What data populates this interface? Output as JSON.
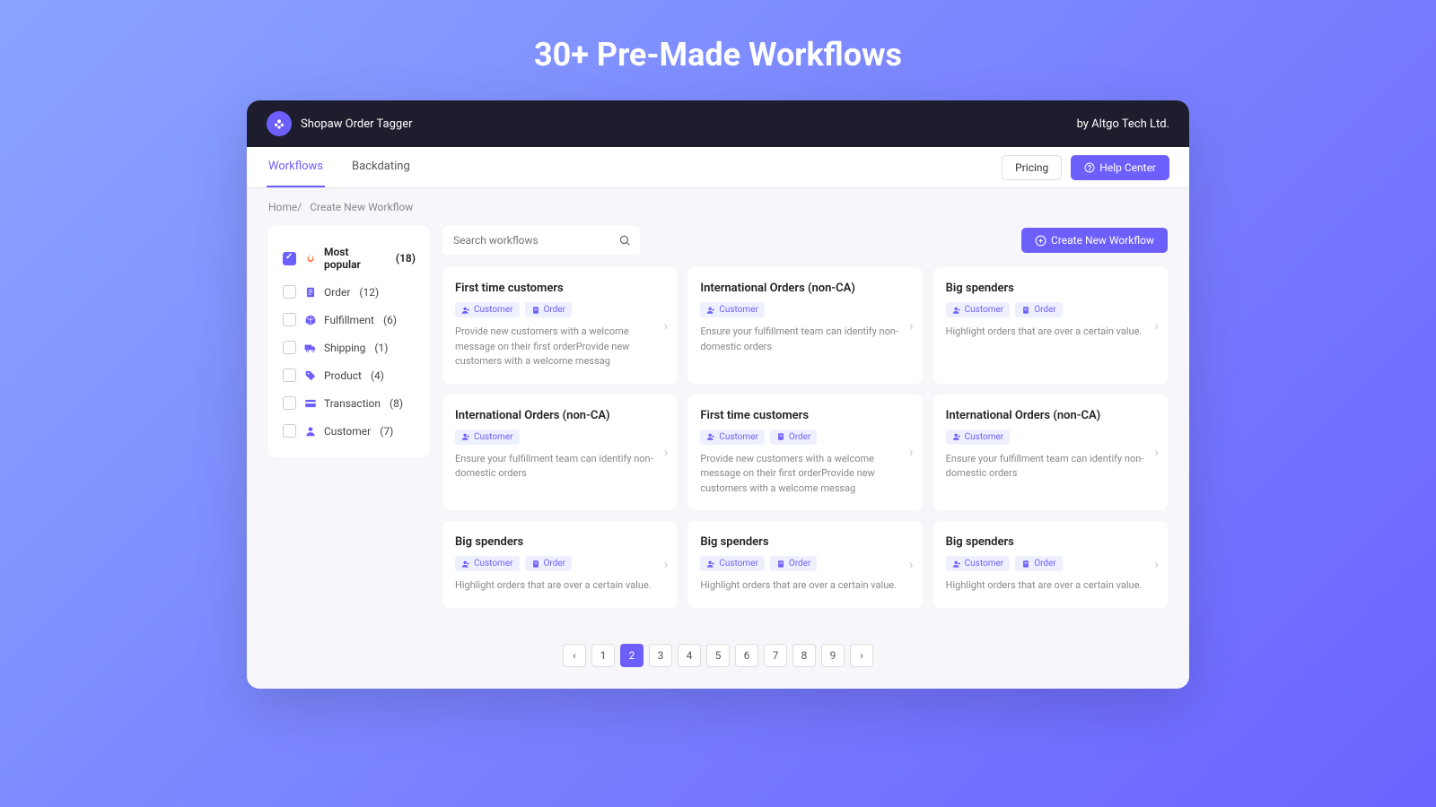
{
  "hero": "30+ Pre-Made Workflows",
  "header": {
    "app_name": "Shopaw Order Tagger",
    "vendor": "by Altgo Tech Ltd."
  },
  "tabs": {
    "workflows": "Workflows",
    "backdating": "Backdating",
    "active": "workflows"
  },
  "actions": {
    "pricing": "Pricing",
    "help": "Help Center"
  },
  "breadcrumb": {
    "home": "Home",
    "sep": "/",
    "current": "Create New Workflow"
  },
  "search": {
    "placeholder": "Search workflows"
  },
  "create_btn": "Create New Workflow",
  "filters": [
    {
      "label": "Most popular",
      "count": "(18)",
      "active": true,
      "icon": "flame",
      "color": "#ff6b35"
    },
    {
      "label": "Order",
      "count": "(12)",
      "active": false,
      "icon": "receipt",
      "color": "#6d5ffc"
    },
    {
      "label": "Fulfillment",
      "count": "(6)",
      "active": false,
      "icon": "box",
      "color": "#6d5ffc"
    },
    {
      "label": "Shipping",
      "count": "(1)",
      "active": false,
      "icon": "truck",
      "color": "#6d5ffc"
    },
    {
      "label": "Product",
      "count": "(4)",
      "active": false,
      "icon": "tag",
      "color": "#6d5ffc"
    },
    {
      "label": "Transaction",
      "count": "(8)",
      "active": false,
      "icon": "card",
      "color": "#6d5ffc"
    },
    {
      "label": "Customer",
      "count": "(7)",
      "active": false,
      "icon": "user",
      "color": "#6d5ffc"
    }
  ],
  "tag_labels": {
    "customer": "Customer",
    "order": "Order"
  },
  "cards": [
    {
      "title": "First time customers",
      "tags": [
        "customer",
        "order"
      ],
      "desc": "Provide new customers with a welcome message on their first orderProvide new customers with a welcome messag"
    },
    {
      "title": "International Orders (non-CA)",
      "tags": [
        "customer"
      ],
      "desc": "Ensure your fulfillment team can identify non-domestic orders"
    },
    {
      "title": "Big spenders",
      "tags": [
        "customer",
        "order"
      ],
      "desc": "Highlight orders that are over a certain value."
    },
    {
      "title": "International Orders (non-CA)",
      "tags": [
        "customer"
      ],
      "desc": "Ensure your fulfillment team can identify non-domestic orders"
    },
    {
      "title": "First time customers",
      "tags": [
        "customer",
        "order"
      ],
      "desc": "Provide new customers with a welcome message on their first orderProvide new customers with a welcome messag"
    },
    {
      "title": "International Orders (non-CA)",
      "tags": [
        "customer"
      ],
      "desc": "Ensure your fulfillment team can identify non-domestic orders"
    },
    {
      "title": "Big spenders",
      "tags": [
        "customer",
        "order"
      ],
      "desc": "Highlight orders that are over a certain value."
    },
    {
      "title": "Big spenders",
      "tags": [
        "customer",
        "order"
      ],
      "desc": "Highlight orders that are over a certain value."
    },
    {
      "title": "Big spenders",
      "tags": [
        "customer",
        "order"
      ],
      "desc": "Highlight orders that are over a certain value."
    }
  ],
  "pagination": {
    "pages": [
      "1",
      "2",
      "3",
      "4",
      "5",
      "6",
      "7",
      "8",
      "9"
    ],
    "active": "2"
  }
}
